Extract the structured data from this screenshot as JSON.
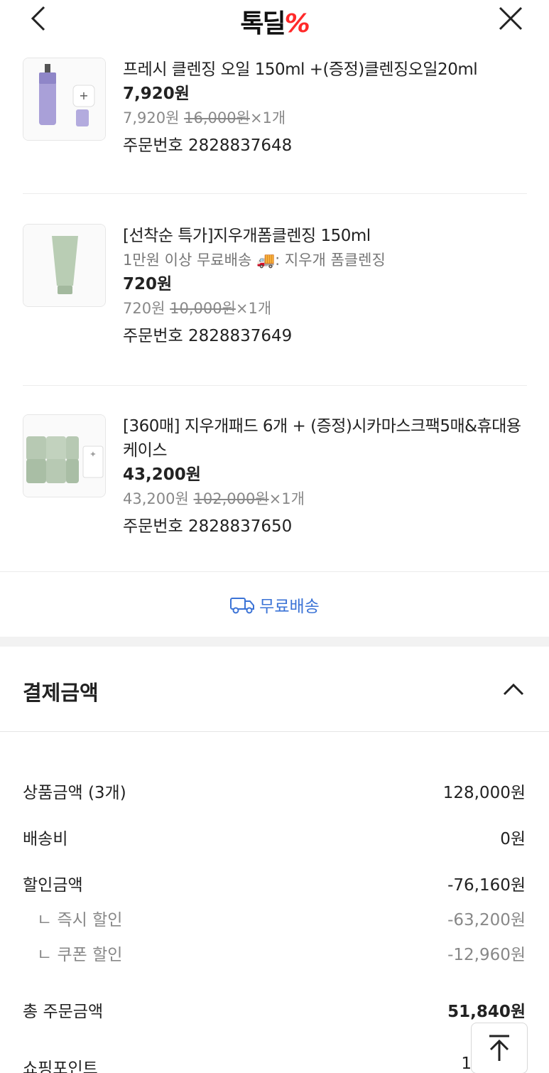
{
  "header": {
    "logo_text": "톡딜",
    "logo_symbol": "%"
  },
  "items": [
    {
      "name": "프레시 클렌징 오일 150ml +(증정)클렌징오일20ml",
      "price": "7,920원",
      "sale_price": "7,920원",
      "original_price": "16,000원",
      "quantity": "×1개",
      "order_number": "주문번호 2828837648"
    },
    {
      "name": "[선착순 특가]지우개폼클렌징 150ml",
      "promo": "1만원 이상 무료배송 🚚: 지우개 폼클렌징",
      "price": "720원",
      "sale_price": "720원",
      "original_price": "10,000원",
      "quantity": "×1개",
      "order_number": "주문번호 2828837649"
    },
    {
      "name": "[360매] 지우개패드 6개 + (증정)시카마스크팩5매&휴대용케이스",
      "price": "43,200원",
      "sale_price": "43,200원",
      "original_price": "102,000원",
      "quantity": "×1개",
      "order_number": "주문번호 2828837650"
    }
  ],
  "shipping": {
    "label": "무료배송",
    "icon": "truck-icon"
  },
  "payment": {
    "title": "결제금액",
    "rows": [
      {
        "label": "상품금액 (3개)",
        "value": "128,000원"
      },
      {
        "label": "배송비",
        "value": "0원"
      },
      {
        "label": "할인금액",
        "value": "-76,160원"
      },
      {
        "label": "ㄴ 즉시 할인",
        "value": "-63,200원"
      },
      {
        "label": "ㄴ 쿠폰 할인",
        "value": "-12,960원"
      },
      {
        "label": "총 주문금액",
        "value": "51,840원"
      },
      {
        "label": "쇼핑포인트",
        "value": "1"
      }
    ]
  },
  "colors": {
    "accent_blue": "#3b73d6",
    "logo_red": "#ff2a2a"
  }
}
